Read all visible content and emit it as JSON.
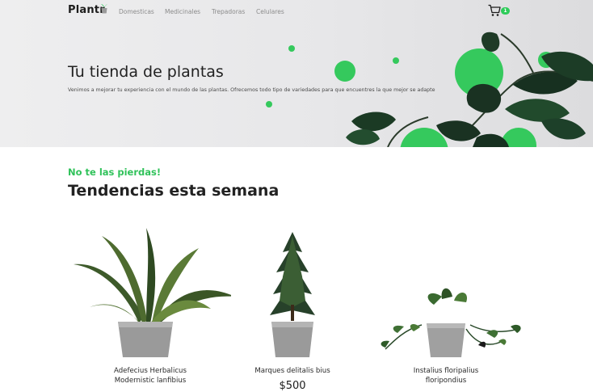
{
  "brand": {
    "name": "Plantr."
  },
  "nav": {
    "links": [
      "Domesticas",
      "Medicinales",
      "Trepadoras",
      "Celulares"
    ],
    "cart_count": "1"
  },
  "hero": {
    "title": "Tu tienda de plantas",
    "subtitle": "Venimos a mejorar tu experiencia con el mundo de las plantas. Ofrecemos todo tipo de variedades para que encuentres la que mejor se adapte"
  },
  "trending": {
    "kicker": "No te las pierdas!",
    "title": "Tendencias esta semana",
    "products": [
      {
        "name_line1": "Adefecius Herbalicus",
        "name_line2": "Modernistic lanfibius"
      },
      {
        "name_line1": "Marques delitalis bius",
        "price": "$500"
      },
      {
        "name_line1": "Instalius floripalius",
        "name_line2": "floripondius"
      }
    ]
  },
  "colors": {
    "accent": "#35c95d",
    "text": "#222222",
    "muted": "#8c8c8c"
  },
  "icons": {
    "cart": "cart-icon",
    "logo_pot": "pot-icon"
  }
}
